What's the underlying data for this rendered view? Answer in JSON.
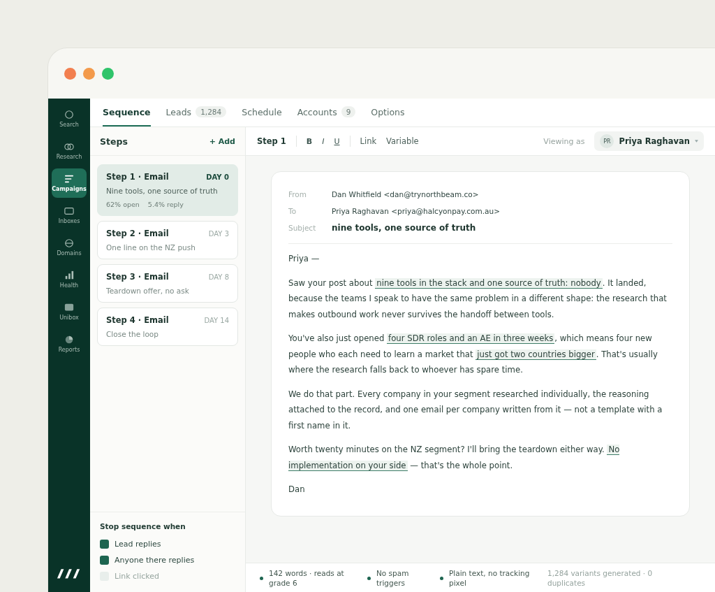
{
  "nav": [
    {
      "label": "Search",
      "selected": false
    },
    {
      "label": "Research",
      "selected": false
    },
    {
      "label": "Campaigns",
      "selected": true
    },
    {
      "label": "Inboxes",
      "selected": false
    },
    {
      "label": "Domains",
      "selected": false
    },
    {
      "label": "Health",
      "selected": false
    },
    {
      "label": "Unibox",
      "selected": false
    },
    {
      "label": "Reports",
      "selected": false
    }
  ],
  "tabs": [
    {
      "label": "Sequence",
      "selected": true
    },
    {
      "label": "Leads",
      "count": "1,284",
      "selected": false
    },
    {
      "label": "Schedule",
      "selected": false
    },
    {
      "label": "Accounts",
      "count": "9",
      "selected": false
    },
    {
      "label": "Options",
      "selected": false
    }
  ],
  "steps_panel": {
    "title": "Steps",
    "add": "+ Add",
    "steps": [
      {
        "title": "Step 1 · Email",
        "day": "DAY 0",
        "subject": "Nine tools, one source of truth",
        "stats": [
          "62% open",
          "5.4% reply"
        ],
        "selected": true
      },
      {
        "title": "Step 2 · Email",
        "day": "DAY 3",
        "subject": "One line on the NZ push",
        "selected": false
      },
      {
        "title": "Step 3 · Email",
        "day": "DAY 8",
        "subject": "Teardown offer, no ask",
        "selected": false
      },
      {
        "title": "Step 4 · Email",
        "day": "DAY 14",
        "subject": "Close the loop",
        "selected": false
      }
    ],
    "stop_title": "Stop sequence when",
    "stop_conditions": [
      {
        "label": "Lead replies",
        "checked": true
      },
      {
        "label": "Anyone there replies",
        "checked": true
      },
      {
        "label": "Link clicked",
        "checked": false
      }
    ]
  },
  "toolbar": {
    "step": "Step 1",
    "format": [
      "B",
      "I",
      "U"
    ],
    "insert": [
      "Link",
      "Variable"
    ],
    "viewing_label": "Viewing as",
    "viewer_initials": "PR",
    "viewer": "Priya Raghavan"
  },
  "email": {
    "headers": [
      {
        "label": "From",
        "value": "Dan Whitfield <dan@trynorthbeam.co>",
        "kind": "plain"
      },
      {
        "label": "To",
        "value": "Priya Raghavan <priya@halcyonpay.com.au>",
        "kind": "plain"
      },
      {
        "label": "Subject",
        "value": "nine tools, one source of truth",
        "kind": "subject"
      }
    ],
    "paragraphs": [
      [
        {
          "text": "Priya —",
          "highlighted": false
        }
      ],
      [
        {
          "text": "Saw your post about ",
          "highlighted": false
        },
        {
          "text": "nine tools in the stack and one source of truth: nobody",
          "highlighted": true
        },
        {
          "text": ". It landed, because the teams I speak to have the same problem in a different shape: the research that makes outbound work never survives the handoff between tools.",
          "highlighted": false
        }
      ],
      [
        {
          "text": "You've also just opened ",
          "highlighted": false
        },
        {
          "text": "four SDR roles and an AE in three weeks",
          "highlighted": true
        },
        {
          "text": ", which means four new people who each need to learn a market that ",
          "highlighted": false
        },
        {
          "text": "just got two countries bigger",
          "highlighted": true
        },
        {
          "text": ". That's usually where the research falls back to whoever has spare time.",
          "highlighted": false
        }
      ],
      [
        {
          "text": "We do that part. Every company in your segment researched individually, the reasoning attached to the record, and one email per company written from it — not a template with a first name in it.",
          "highlighted": false
        }
      ],
      [
        {
          "text": "Worth twenty minutes on the NZ segment? I'll bring the teardown either way. ",
          "highlighted": false
        },
        {
          "text": "No implementation on your side",
          "highlighted": true
        },
        {
          "text": " — that's the whole point.",
          "highlighted": false
        }
      ],
      [
        {
          "text": "Dan",
          "highlighted": false
        }
      ]
    ]
  },
  "footer": [
    {
      "text": "142 words · reads at grade 6",
      "kind": "check"
    },
    {
      "text": "No spam triggers",
      "kind": "check"
    },
    {
      "text": "Plain text, no tracking pixel",
      "kind": "check"
    },
    {
      "text": "1,284 variants generated · 0 duplicates",
      "kind": "note"
    }
  ]
}
